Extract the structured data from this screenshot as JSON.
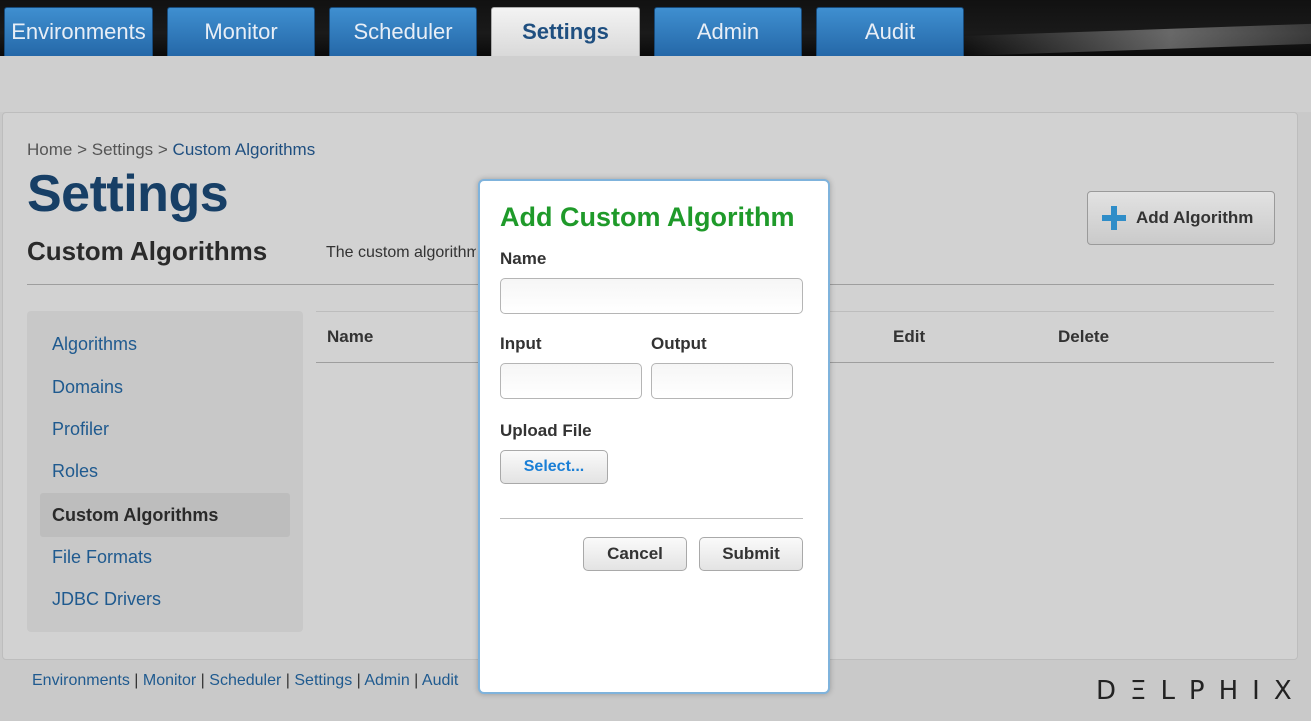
{
  "nav": {
    "tabs": [
      {
        "label": "Environments"
      },
      {
        "label": "Monitor"
      },
      {
        "label": "Scheduler"
      },
      {
        "label": "Settings",
        "active": true
      },
      {
        "label": "Admin"
      },
      {
        "label": "Audit"
      }
    ]
  },
  "breadcrumb": {
    "home": "Home",
    "sep": " > ",
    "settings": "Settings",
    "current": "Custom Algorithms"
  },
  "page": {
    "title": "Settings",
    "section_title": "Custom Algorithms",
    "description": "The custom algorithm",
    "add_button": "Add Algorithm"
  },
  "sidebar": {
    "items": [
      {
        "label": "Algorithms"
      },
      {
        "label": "Domains"
      },
      {
        "label": "Profiler"
      },
      {
        "label": "Roles"
      },
      {
        "label": "Custom Algorithms",
        "active": true
      },
      {
        "label": "File Formats"
      },
      {
        "label": "JDBC Drivers"
      }
    ]
  },
  "table": {
    "headers": {
      "name": "Name",
      "edit": "Edit",
      "delete": "Delete"
    }
  },
  "modal": {
    "title": "Add Custom Algorithm",
    "name_label": "Name",
    "name_value": "",
    "input_label": "Input",
    "input_value": "",
    "output_label": "Output",
    "output_value": "",
    "upload_label": "Upload File",
    "select_button": "Select...",
    "cancel_button": "Cancel",
    "submit_button": "Submit"
  },
  "footer": {
    "links": [
      "Environments",
      "Monitor",
      "Scheduler",
      "Settings",
      "Admin",
      "Audit"
    ],
    "separator": " | ",
    "logo": "DΞLPHIX"
  },
  "colors": {
    "tab_blue": "#2f7cbf",
    "heading_blue": "#173f66",
    "link_blue": "#1f5a8f",
    "modal_title_green": "#1f9a2a",
    "select_blue": "#1a7fd6",
    "plus_blue": "#2f8dc8"
  }
}
